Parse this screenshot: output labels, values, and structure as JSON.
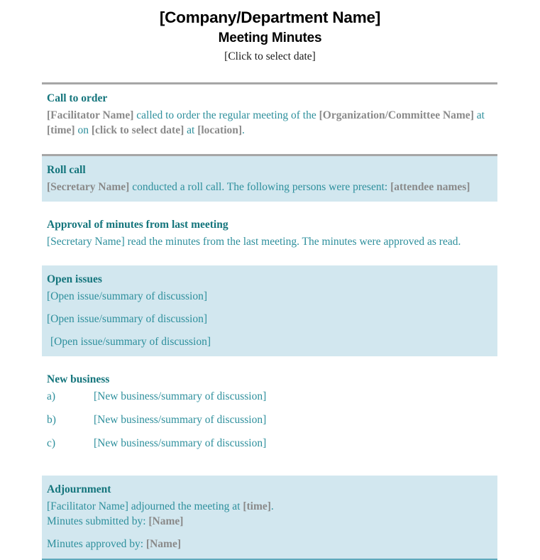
{
  "document": {
    "title": "[Company/Department Name]",
    "subtitle": "Meeting Minutes",
    "date_placeholder": "[Click to select date]"
  },
  "sections": {
    "call_to_order": {
      "heading": "Call to order",
      "facilitator_field": "[Facilitator Name]",
      "text_1": " called to order the regular meeting of the ",
      "organization_field": "[Organization/Committee Name]",
      "text_2": " at ",
      "time_field": "[time]",
      "text_3": " on ",
      "date_field": "[click to select date]",
      "text_4": " at ",
      "location_field": "[location]",
      "text_5": "."
    },
    "roll_call": {
      "heading": "Roll call",
      "secretary_field": "[Secretary Name]",
      "text_1": " conducted a roll call. The following persons were present: ",
      "attendees_field": "[attendee names]"
    },
    "approval_of_minutes": {
      "heading": "Approval of minutes from last meeting",
      "secretary_field": "[Secretary Name]",
      "text_1": " read the minutes from the last meeting. The minutes were approved as read."
    },
    "open_issues": {
      "heading": "Open issues",
      "items": [
        "[Open issue/summary of discussion]",
        "[Open issue/summary of discussion]",
        "[Open issue/summary of discussion]"
      ]
    },
    "new_business": {
      "heading": "New business",
      "items": [
        {
          "marker": "a)",
          "text": "[New business/summary of discussion]"
        },
        {
          "marker": "b)",
          "text": "[New business/summary of discussion]"
        },
        {
          "marker": "c)",
          "text": "[New business/summary of discussion]"
        }
      ]
    },
    "adjournment": {
      "heading": "Adjournment",
      "facilitator_field": "[Facilitator Name]",
      "text_1": " adjourned the meeting at ",
      "time_field": "[time]",
      "text_2": ".",
      "submitted_label": "Minutes submitted by:  ",
      "submitted_field": "[Name]",
      "approved_label": "Minutes approved by:  ",
      "approved_field": "[Name]"
    }
  },
  "colors": {
    "heading_teal": "#14757c",
    "body_teal": "#2d8f9c",
    "field_gray": "#8a8a8a",
    "band_blue": "#d2e7ef",
    "rule_gray": "#a6a6a6",
    "rule_teal": "#5fa9bd"
  }
}
